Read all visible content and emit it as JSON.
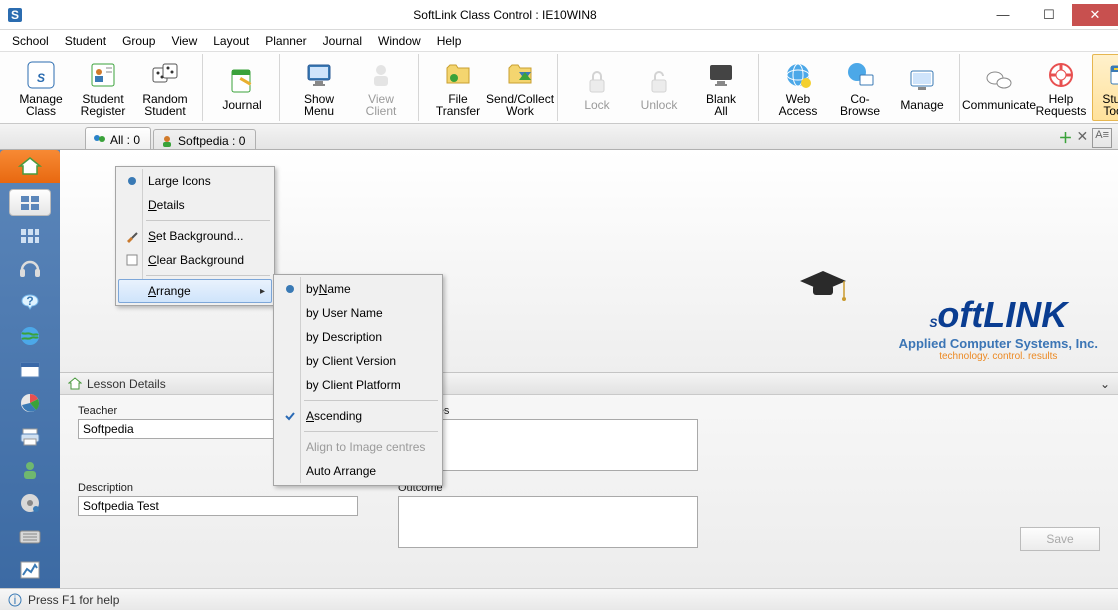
{
  "window": {
    "title": "SoftLink Class Control : IE10WIN8"
  },
  "menubar": [
    "School",
    "Student",
    "Group",
    "View",
    "Layout",
    "Planner",
    "Journal",
    "Window",
    "Help"
  ],
  "ribbon": {
    "groups": [
      {
        "buttons": [
          {
            "name": "manage-class",
            "label": "Manage\nClass",
            "icon": "s-logo",
            "enabled": true
          },
          {
            "name": "student-register",
            "label": "Student\nRegister",
            "icon": "register",
            "enabled": true
          },
          {
            "name": "random-student",
            "label": "Random\nStudent",
            "icon": "dice",
            "enabled": true
          }
        ]
      },
      {
        "buttons": [
          {
            "name": "journal",
            "label": "Journal",
            "icon": "journal",
            "enabled": true
          }
        ]
      },
      {
        "buttons": [
          {
            "name": "show-menu",
            "label": "Show\nMenu",
            "icon": "monitor",
            "enabled": true
          },
          {
            "name": "view-client",
            "label": "View\nClient",
            "icon": "user-gray",
            "enabled": false
          }
        ]
      },
      {
        "buttons": [
          {
            "name": "file-transfer",
            "label": "File\nTransfer",
            "icon": "folder",
            "enabled": true
          },
          {
            "name": "send-collect",
            "label": "Send/Collect\nWork",
            "icon": "send",
            "enabled": true
          }
        ]
      },
      {
        "buttons": [
          {
            "name": "lock",
            "label": "Lock",
            "icon": "lock",
            "enabled": false
          },
          {
            "name": "unlock",
            "label": "Unlock",
            "icon": "unlock",
            "enabled": false
          },
          {
            "name": "blank-all",
            "label": "Blank\nAll",
            "icon": "blank",
            "enabled": true
          }
        ]
      },
      {
        "buttons": [
          {
            "name": "web-access",
            "label": "Web\nAccess",
            "icon": "globe",
            "enabled": true
          },
          {
            "name": "co-browse",
            "label": "Co-Browse",
            "icon": "cobrowse",
            "enabled": true
          },
          {
            "name": "manage",
            "label": "Manage",
            "icon": "monitor2",
            "enabled": true
          }
        ]
      },
      {
        "buttons": [
          {
            "name": "communicate",
            "label": "Communicate",
            "icon": "chat",
            "enabled": true
          },
          {
            "name": "help-requests",
            "label": "Help\nRequests",
            "icon": "life-ring",
            "enabled": true
          },
          {
            "name": "student-toolbar",
            "label": "Student\nToolbar",
            "icon": "toolbar",
            "enabled": true,
            "selected": true
          }
        ]
      }
    ]
  },
  "tabs": [
    {
      "label": "All : 0",
      "active": true,
      "icon": "users"
    },
    {
      "label": "Softpedia : 0",
      "active": false,
      "icon": "user-green"
    }
  ],
  "context_menu_1": {
    "items": [
      {
        "label": "Large Icons",
        "icon": "radio-on"
      },
      {
        "label": "Details",
        "underline": "D"
      },
      {
        "sep": true
      },
      {
        "label": "Set Background...",
        "icon": "brush",
        "underline": "S"
      },
      {
        "label": "Clear Background",
        "icon": "square",
        "underline": "C"
      },
      {
        "sep": true
      },
      {
        "label": "Arrange",
        "submenu": true,
        "hover": true,
        "underline": "A"
      }
    ]
  },
  "context_menu_2": {
    "items": [
      {
        "label": "by Name",
        "icon": "radio-on",
        "underline": "N"
      },
      {
        "label": "by User Name"
      },
      {
        "label": "by Description"
      },
      {
        "label": "by Client Version"
      },
      {
        "label": "by Client Platform"
      },
      {
        "sep": true
      },
      {
        "label": "Ascending",
        "icon": "check",
        "underline": "A"
      },
      {
        "sep": true
      },
      {
        "label": "Align to Image centres",
        "disabled": true
      },
      {
        "label": "Auto Arrange"
      }
    ]
  },
  "lesson_details": {
    "header": "Lesson Details",
    "teacher_label": "Teacher",
    "teacher_value": "Softpedia",
    "objectives_label": "Objectives",
    "objectives_value": "",
    "description_label": "Description",
    "description_value": "Softpedia Test",
    "outcome_label": "Outcome",
    "outcome_value": "",
    "save_label": "Save"
  },
  "logo": {
    "brand": "SoftLINK",
    "sub1": "Applied Computer Systems, Inc.",
    "sub2": "technology. control. results"
  },
  "statusbar": {
    "text": "Press F1 for help"
  }
}
